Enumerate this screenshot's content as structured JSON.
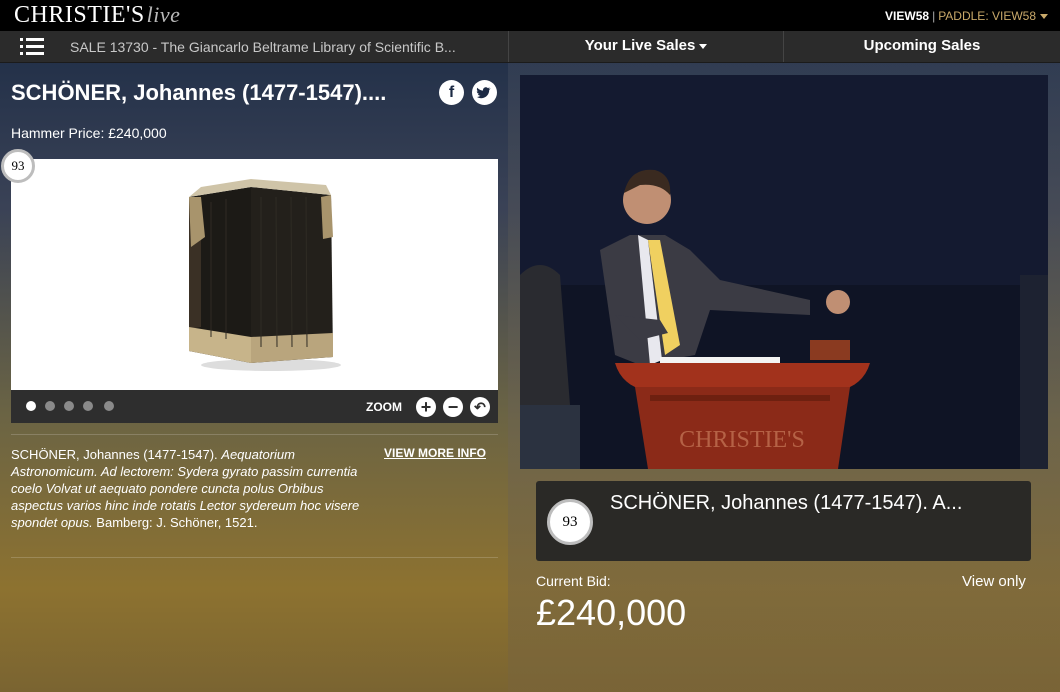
{
  "header": {
    "brand": "CHRISTIE'S",
    "brand_suffix": "live",
    "account": "VIEW58",
    "separator": "|",
    "paddle": "PADDLE: VIEW58"
  },
  "subnav": {
    "sale_title": "SALE 13730 - The Giancarlo Beltrame Library of Scientific B...",
    "tabs": [
      {
        "label": "Your Live Sales"
      },
      {
        "label": "Upcoming Sales"
      }
    ]
  },
  "lot": {
    "number": "93",
    "title": "SCHÖNER, Johannes (1477-1547)....",
    "hammer_price": "Hammer Price: £240,000",
    "zoom_label": "ZOOM",
    "description_plain": "SCHÖNER, Johannes (1477-1547). ",
    "description_italic": "Aequatorium Astronomicum. Ad lectorem: Sydera gyrato passim currentia coelo Volvat ut aequato pondere cuncta polus Orbibus aspectus varios hinc inde rotatis Lector sydereum hoc visere spondet opus.",
    "description_tail": " Bamberg: J. Schöner, 1521.",
    "view_more": "VIEW MORE INFO",
    "carousel_count": 5
  },
  "live": {
    "lot_number": "93",
    "lot_title": "SCHÖNER, Johannes (1477-1547). A...",
    "current_bid_label": "Current Bid:",
    "current_bid": "£240,000",
    "view_only": "View only",
    "podium_text": "CHRISTIE'S"
  },
  "icons": {
    "facebook": "facebook-icon",
    "twitter": "twitter-icon",
    "menu": "menu-icon",
    "zoom_in": "zoom-in-icon",
    "zoom_out": "zoom-out-icon",
    "reset": "reset-icon"
  }
}
